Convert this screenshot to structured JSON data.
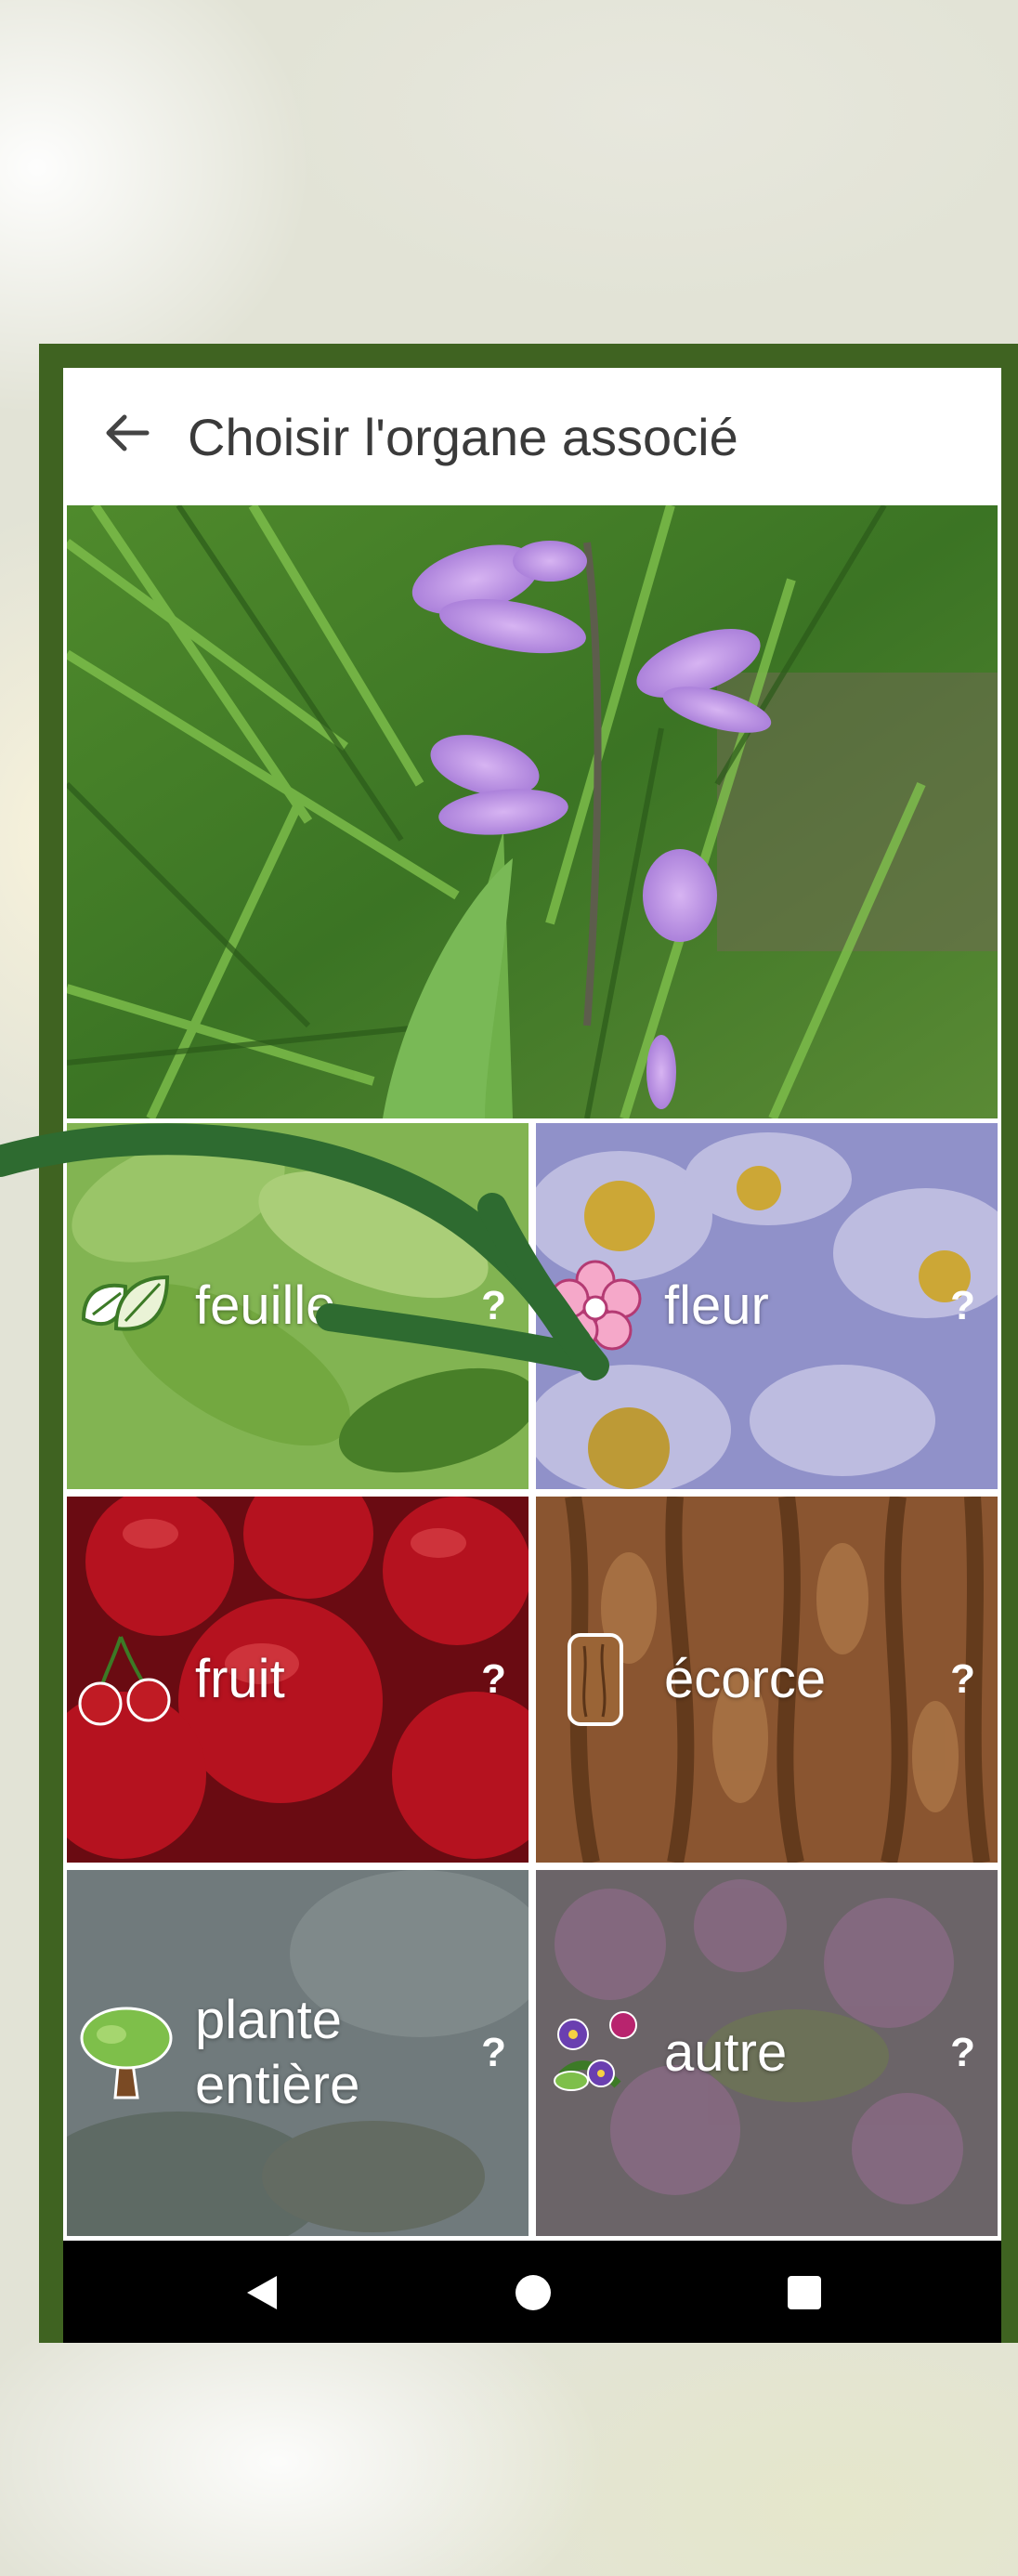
{
  "header": {
    "title": "Choisir l'organe associé"
  },
  "organs": [
    {
      "label": "feuille",
      "help": "?",
      "icon": "leaf-icon"
    },
    {
      "label": "fleur",
      "help": "?",
      "icon": "flower-icon"
    },
    {
      "label": "fruit",
      "help": "?",
      "icon": "cherry-icon"
    },
    {
      "label": "écorce",
      "help": "?",
      "icon": "bark-icon"
    },
    {
      "label": "plante entière",
      "help": "?",
      "icon": "tree-icon"
    },
    {
      "label": "autre",
      "help": "?",
      "icon": "bouquet-icon"
    }
  ],
  "colors": {
    "frame": "#3f6321",
    "arrow": "#2e6b30",
    "navbar": "#000000"
  }
}
